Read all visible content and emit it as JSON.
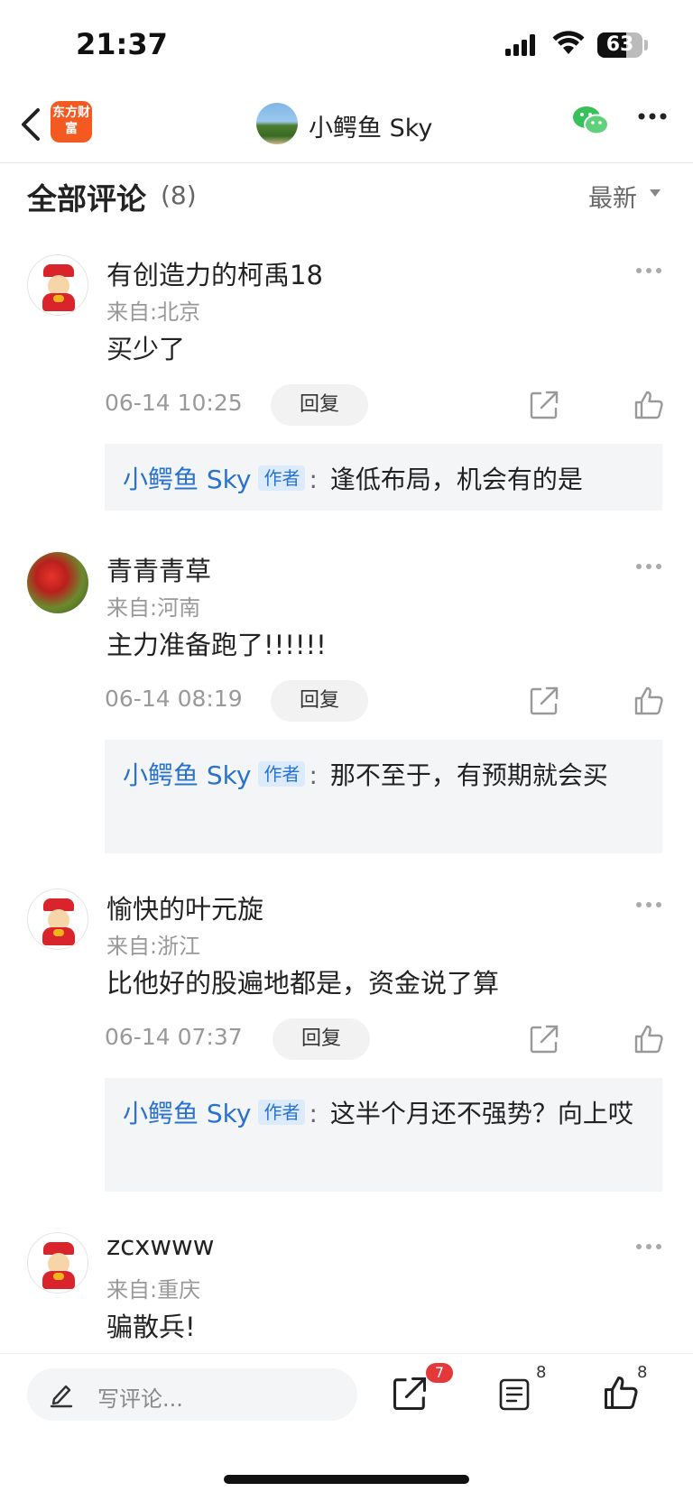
{
  "status_bar": {
    "time": "21:37",
    "battery": "63",
    "battery_level": 0.63
  },
  "nav": {
    "logo_text": "东方财富",
    "title": "小鳄鱼 Sky"
  },
  "header": {
    "title": "全部评论",
    "count": "(8)",
    "sort": "最新"
  },
  "comments": [
    {
      "name": "有创造力的柯禹18",
      "location": "来自:北京",
      "text": "买少了",
      "date": "06-14 10:25",
      "reply_label": "回复",
      "reply": {
        "author": "小鳄鱼 Sky",
        "badge": "作者",
        "colon": ":",
        "text": "逢低布局，机会有的是"
      }
    },
    {
      "name": "青青青草",
      "location": "来自:河南",
      "text": "主力准备跑了!!!!!!",
      "date": "06-14 08:19",
      "reply_label": "回复",
      "reply": {
        "author": "小鳄鱼 Sky",
        "badge": "作者",
        "colon": ":",
        "text": "那不至于，有预期就会买"
      }
    },
    {
      "name": "愉快的叶元旋",
      "location": "来自:浙江",
      "text": "比他好的股遍地都是，资金说了算",
      "date": "06-14 07:37",
      "reply_label": "回复",
      "reply": {
        "author": "小鳄鱼 Sky",
        "badge": "作者",
        "colon": ":",
        "text": "这半个月还不强势？向上哎"
      }
    },
    {
      "name": "zcxwww",
      "location": "来自:重庆",
      "text": "骗散兵!"
    }
  ],
  "bottom_bar": {
    "placeholder": "写评论...",
    "share_badge": "7",
    "comment_count": "8",
    "like_count": "8"
  },
  "colors": {
    "accent_blue": "#2a73cc",
    "badge_red": "#e5383b",
    "logo_orange": "#f35a22"
  }
}
